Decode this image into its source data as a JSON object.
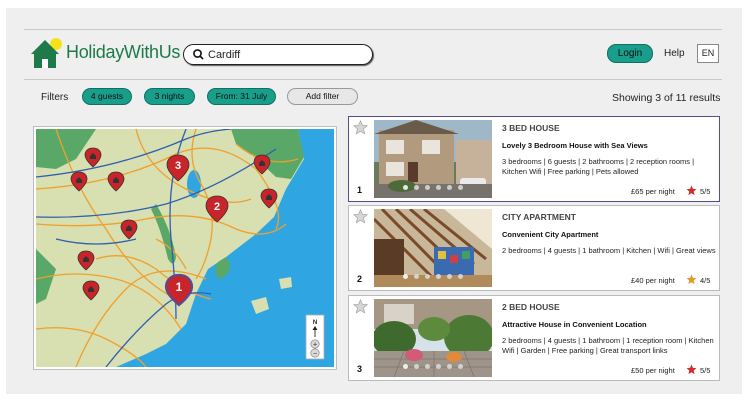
{
  "header": {
    "brand": "HolidayWithUs",
    "search_value": "Cardiff",
    "login_label": "Login",
    "help_label": "Help",
    "lang_label": "EN"
  },
  "filters": {
    "label": "Filters",
    "chips": [
      "4 guests",
      "3 nights",
      "From: 31 July"
    ],
    "add_label": "Add filter",
    "results_text": "Showing 3 of 11 results"
  },
  "map": {
    "compass_label": "N",
    "zoom_in": "+",
    "zoom_out": "−",
    "numbered_pins": [
      "1",
      "2",
      "3"
    ],
    "colors": {
      "sea": "#2fa6e2",
      "land": "#d8dfb1",
      "green": "#5aa868",
      "roads": "#f0a02a",
      "pin": "#c8242a",
      "pin_selected": "#5a4a8f"
    }
  },
  "listings": [
    {
      "num": "1",
      "type": "3 BED HOUSE",
      "title": "Lovely 3 Bedroom House with Sea Views",
      "features": "3 bedrooms | 6 guests | 2 bathrooms | 2 reception rooms | Kitchen Wifi | Free parking | Pets allowed",
      "price": "£65 per night",
      "rating": "5/5",
      "rating_color": "#d32a2a",
      "selected": true
    },
    {
      "num": "2",
      "type": "CITY APARTMENT",
      "title": "Convenient City Apartment",
      "features": "2 bedrooms | 4 guests | 1 bathroom | Kitchen | Wifi | Great views",
      "price": "£40 per night",
      "rating": "4/5",
      "rating_color": "#e39a2a",
      "selected": false
    },
    {
      "num": "3",
      "type": "2 BED HOUSE",
      "title": "Attractive House in Convenient Location",
      "features": "2 bedrooms | 4 guests | 1 bathroom | 1 reception room | Kitchen Wifi | Garden | Free parking | Great transport links",
      "price": "£50 per night",
      "rating": "5/5",
      "rating_color": "#d32a2a",
      "selected": false
    }
  ]
}
